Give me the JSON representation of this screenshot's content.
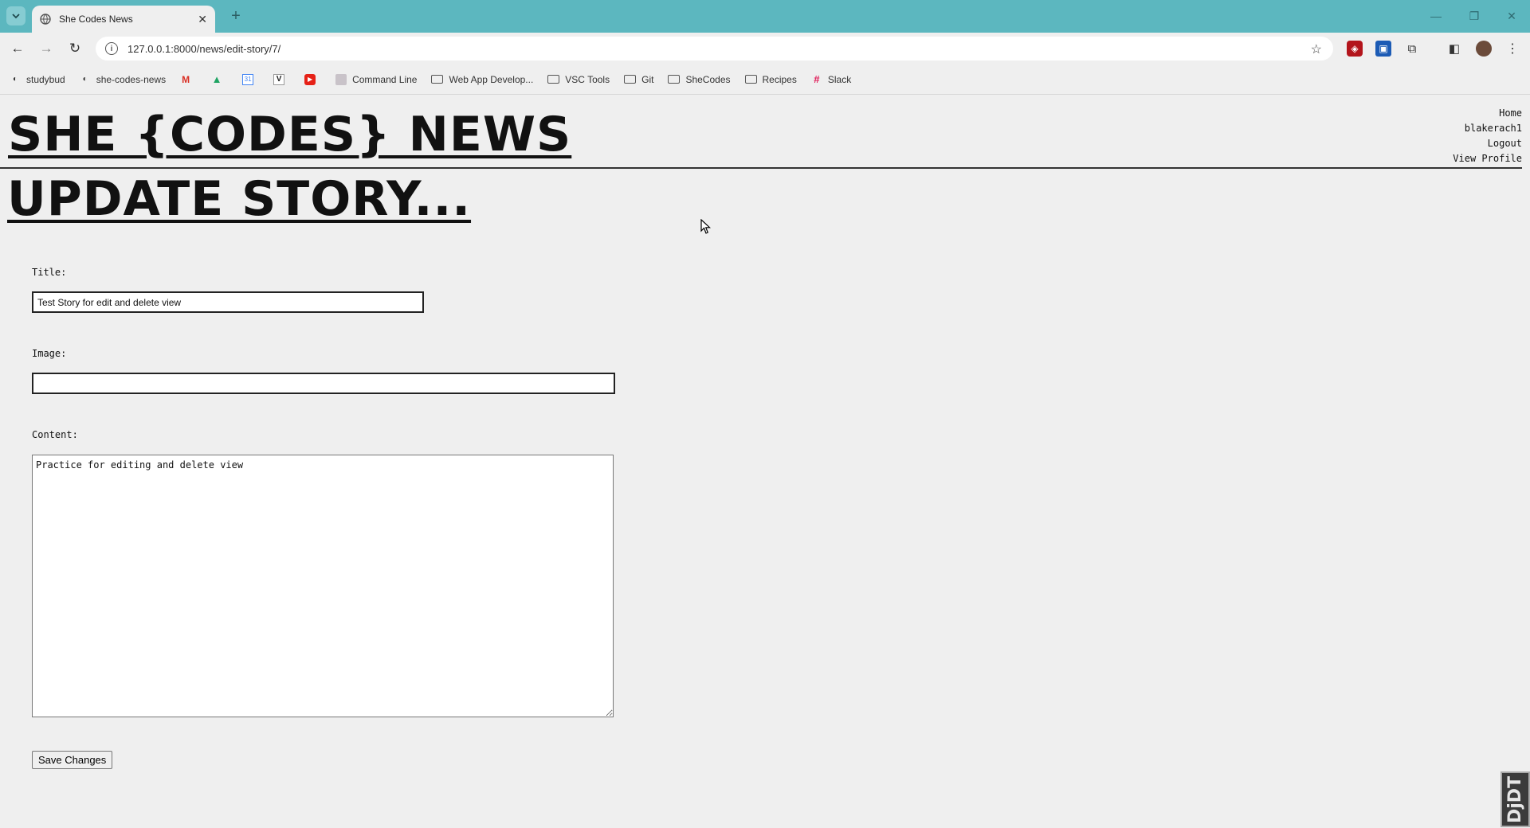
{
  "browser": {
    "tab_title": "She Codes News",
    "url": "127.0.0.1:8000/news/edit-story/7/",
    "bookmarks": [
      {
        "label": "studybud",
        "icon": "globe-icon"
      },
      {
        "label": "she-codes-news",
        "icon": "globe-icon"
      },
      {
        "label": "",
        "icon": "gmail-icon"
      },
      {
        "label": "",
        "icon": "drive-icon"
      },
      {
        "label": "",
        "icon": "calendar-icon"
      },
      {
        "label": "",
        "icon": "v-icon"
      },
      {
        "label": "",
        "icon": "youtube-icon"
      },
      {
        "label": "Command Line",
        "icon": "page-icon"
      },
      {
        "label": "Web App Develop...",
        "icon": "folder-icon"
      },
      {
        "label": "VSC Tools",
        "icon": "folder-icon"
      },
      {
        "label": "Git",
        "icon": "folder-icon"
      },
      {
        "label": "SheCodes",
        "icon": "folder-icon"
      },
      {
        "label": "Recipes",
        "icon": "folder-icon"
      },
      {
        "label": "Slack",
        "icon": "slack-icon"
      }
    ]
  },
  "site": {
    "title": "SHE {CODES} NEWS",
    "nav": [
      "Home",
      "blakerach1",
      "Logout",
      "View Profile"
    ]
  },
  "page": {
    "heading": "UPDATE STORY...",
    "form": {
      "title_label": "Title:",
      "title_value": "Test Story for edit and delete view",
      "image_label": "Image:",
      "image_value": "",
      "content_label": "Content:",
      "content_value": "Practice for editing and delete view",
      "submit_label": "Save Changes"
    }
  },
  "debug_toolbar": {
    "label": "DjDT"
  }
}
